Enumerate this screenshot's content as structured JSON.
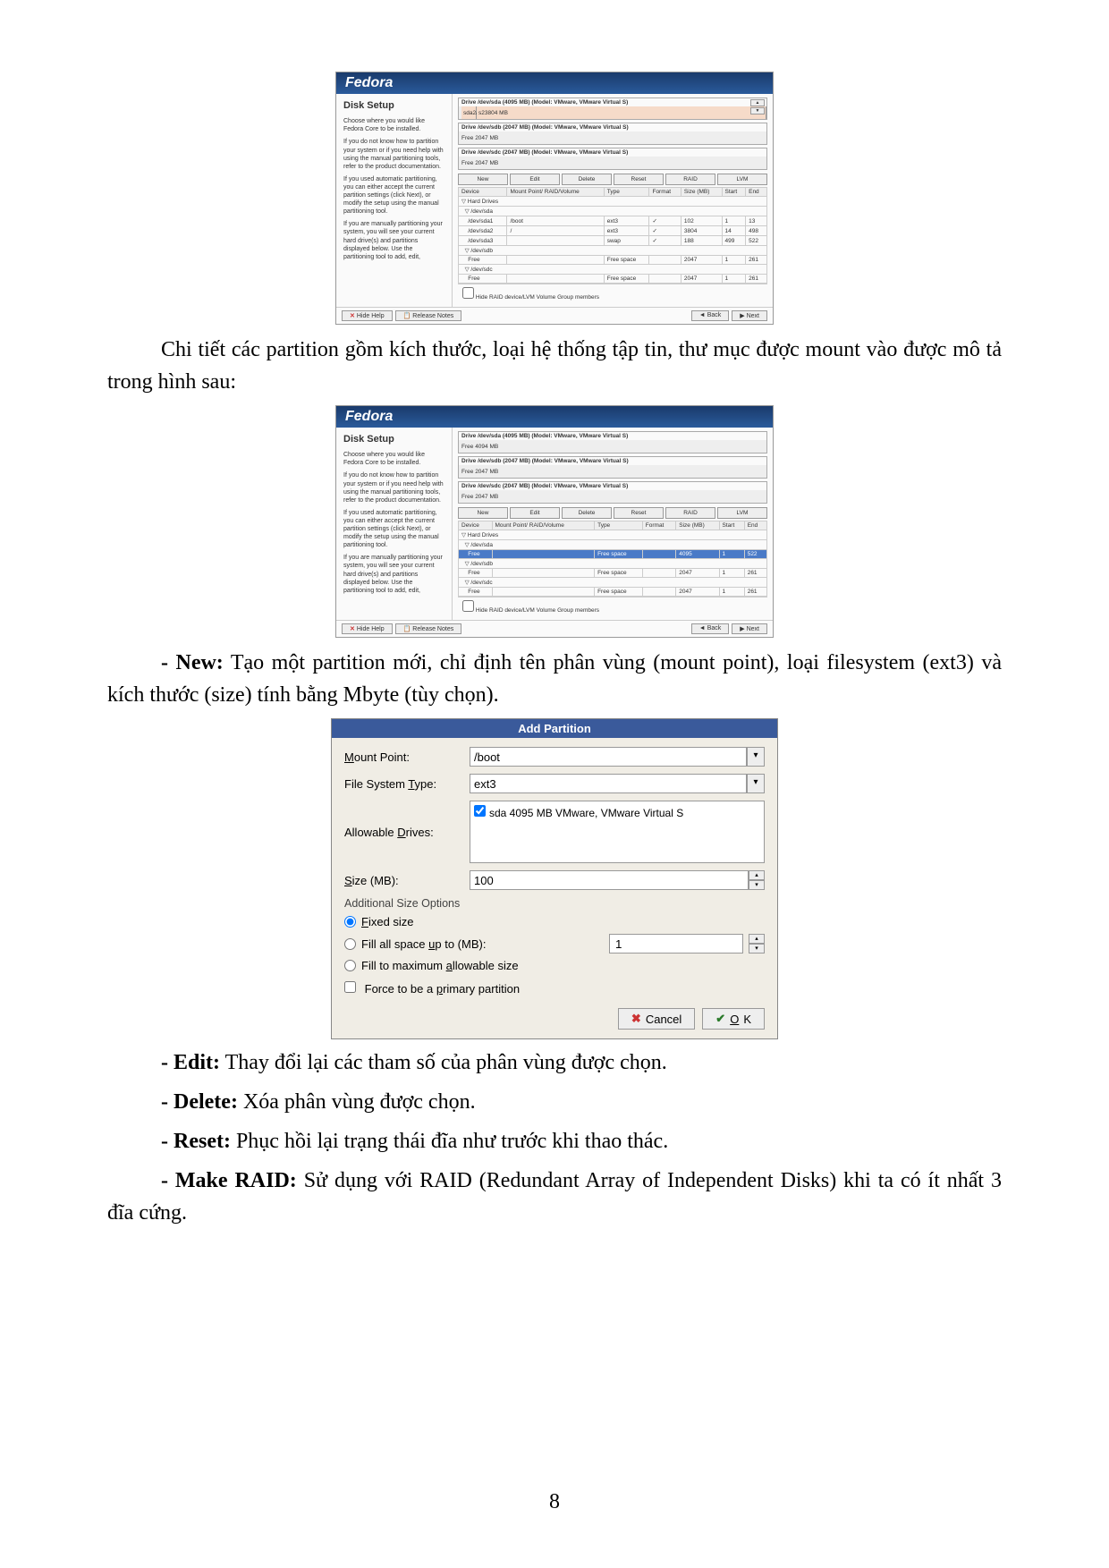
{
  "fedora": {
    "brand": "Fedora",
    "title": "Disk Setup",
    "help_p1": "Choose where you would like Fedora Core to be installed.",
    "help_p2": "If you do not know how to partition your system or if you need help with using the manual partitioning tools, refer to the product documentation.",
    "help_p3": "If you used automatic partitioning, you can either accept the current partition settings (click Next), or modify the setup using the manual partitioning tool.",
    "help_p4": "If you are manually partitioning your system, you will see your current hard drive(s) and partitions displayed below. Use the partitioning tool to add, edit,",
    "drive_a": "Drive /dev/sda (4095 MB) (Model: VMware, VMware Virtual S)",
    "drive_b": "Drive /dev/sdb (2047 MB) (Model: VMware, VMware Virtual S)",
    "drive_c": "Drive /dev/sdc (2047 MB) (Model: VMware, VMware Virtual S)",
    "seg_a1": "sda2/sd2",
    "seg_a2": "s23804 MB",
    "seg_free": "Free",
    "seg_free_size": "4094 MB",
    "seg_b": "Free",
    "seg_b_size": "2047 MB",
    "seg_c": "Free",
    "seg_c_size": "2047 MB",
    "btn_new": "New",
    "btn_edit": "Edit",
    "btn_delete": "Delete",
    "btn_reset": "Reset",
    "btn_raid": "RAID",
    "btn_lvm": "LVM",
    "col_device": "Device",
    "col_mount": "Mount Point/ RAID/Volume",
    "col_type": "Type",
    "col_format": "Format",
    "col_size": "Size (MB)",
    "col_start": "Start",
    "col_end": "End",
    "hd_label": "Hard Drives",
    "sda": "/dev/sda",
    "sda1": "/dev/sda1",
    "sda2": "/dev/sda2",
    "sda3": "/dev/sda3",
    "sdb": "/dev/sdb",
    "sdc": "/dev/sdc",
    "boot": "/boot",
    "root": "/",
    "ext3": "ext3",
    "swap": "swap",
    "free_space": "Free space",
    "row_free": "Free",
    "chk_label": "Hide RAID device/LVM Volume Group members",
    "hide_help": "Hide Help",
    "release_notes": "Release Notes",
    "back": "Back",
    "next": "Next",
    "tri_left": "◄",
    "tri_right": "▶",
    "r1": {
      "size": "102",
      "start": "1",
      "end": "13"
    },
    "r2": {
      "size": "3804",
      "start": "14",
      "end": "498"
    },
    "r3": {
      "size": "188",
      "start": "499",
      "end": "522"
    },
    "r4": {
      "size": "2047",
      "start": "1",
      "end": "261"
    },
    "r5": {
      "size": "2047",
      "start": "1",
      "end": "261"
    },
    "sel": {
      "size": "4095",
      "start": "1",
      "end": "522"
    }
  },
  "text": {
    "para1": "Chi tiết các partition gồm kích thước, loại hệ thống tập tin, thư mục được mount vào được mô tả trong hình sau:",
    "new_label": "- New:",
    "new_text": " Tạo một partition mới, chỉ định tên phân vùng (mount point), loại filesystem (ext3) và kích thước (size) tính bằng Mbyte (tùy chọn).",
    "edit_label": "- Edit:",
    "edit_text": " Thay đổi lại các tham số của phân vùng được chọn.",
    "delete_label": "- Delete:",
    "delete_text": " Xóa phân vùng được chọn.",
    "reset_label": "- Reset:",
    "reset_text": " Phục hồi lại trạng thái đĩa như trước khi thao thác.",
    "raid_label": "- Make RAID:",
    "raid_text": " Sử dụng với RAID (Redundant Array of Independent Disks) khi ta có ít nhất 3 đĩa cứng.",
    "page": "8"
  },
  "dialog": {
    "title": "Add Partition",
    "mount_label": "Mount Point:",
    "mount_value": "/boot",
    "fstype_label": "File System Type:",
    "fstype_value": "ext3",
    "drives_label": "Allowable Drives:",
    "drive_entry": "sda    4095 MB  VMware, VMware Virtual S",
    "size_label": "Size (MB):",
    "size_value": "100",
    "section": "Additional Size Options",
    "fixed": "Fixed size",
    "fillup": "Fill all space up to (MB):",
    "fillup_val": "1",
    "fillmax": "Fill to maximum allowable size",
    "primary": "Force to be a primary partition",
    "cancel": "Cancel",
    "ok": "OK"
  }
}
